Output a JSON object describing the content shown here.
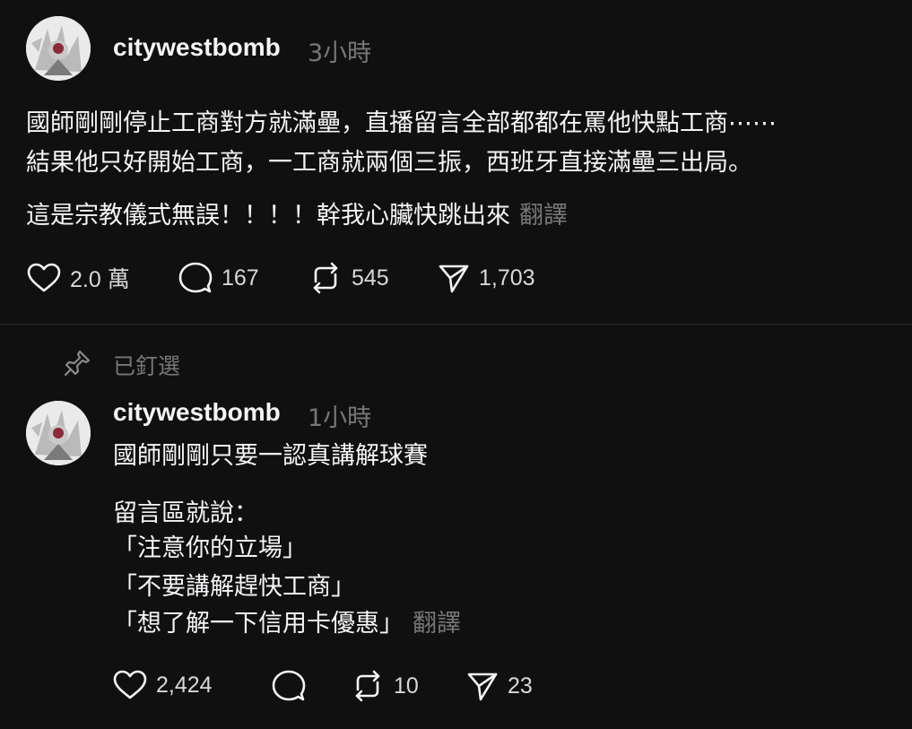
{
  "post1": {
    "username": "citywestbomb",
    "time": "3小時",
    "lines": [
      "國師剛剛停止工商對方就滿壘，直播留言全部都都在罵他快點工商⋯⋯",
      "結果他只好開始工商，一工商就兩個三振，西班牙直接滿壘三出局。"
    ],
    "line3": "這是宗教儀式無誤！！！！幹我心臟快跳出來",
    "translate": "翻譯",
    "likes": "2.0 萬",
    "comments": "167",
    "reposts": "545",
    "shares": "1,703"
  },
  "pinned": {
    "label": "已釘選"
  },
  "post2": {
    "username": "citywestbomb",
    "time": "1小時",
    "line1": "國師剛剛只要一認真講解球賽",
    "lines": [
      "留言區就說：",
      "「注意你的立場」",
      "「不要講解趕快工商」"
    ],
    "last_line": "「想了解一下信用卡優惠」",
    "translate": "翻譯",
    "likes": "2,424",
    "comments": "",
    "reposts": "10",
    "shares": "23"
  },
  "colors": {
    "background": "#101010",
    "text": "#f3f5f7",
    "secondary": "#777777",
    "divider": "#2e2e2e"
  },
  "icons": {
    "like": "heart-icon",
    "comment": "comment-bubble-icon",
    "repost": "repost-icon",
    "share": "send-icon",
    "pin": "pin-icon"
  }
}
